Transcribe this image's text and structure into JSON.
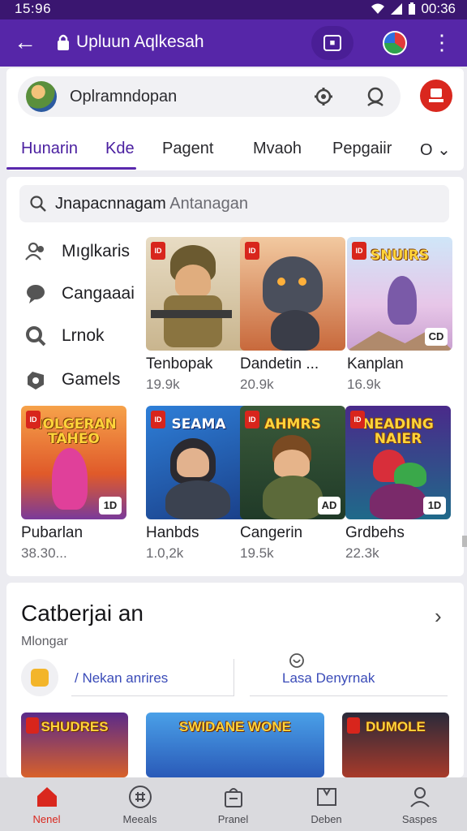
{
  "status_bar": {
    "time": "15:96",
    "clock_right": "00:36"
  },
  "app_bar": {
    "url_text": "Upluun Aqlkesah"
  },
  "top_card": {
    "search_placeholder": "Oplramndopan",
    "tabs": [
      {
        "label": "Hunarin"
      },
      {
        "label": "Kde"
      },
      {
        "label": "Pagent"
      },
      {
        "label": "Mvaoh"
      },
      {
        "label": "Pepgaiir"
      },
      {
        "label": "O"
      }
    ]
  },
  "main": {
    "search_value": "Jnapacnnagam",
    "search_placeholder": "Antanagan",
    "sidebar": [
      {
        "label": "Mıglkaris",
        "icon": "users-icon"
      },
      {
        "label": "Cangaaai",
        "icon": "chat-icon"
      },
      {
        "label": "Lrnok",
        "icon": "search-icon"
      },
      {
        "label": "Gamels",
        "icon": "gamepad-icon"
      }
    ],
    "games_row1": [
      {
        "name": "Tenbopak",
        "count": "19.9k",
        "badge": "ID",
        "banner": ""
      },
      {
        "name": "Dandetin ...",
        "count": "20.9k",
        "badge": "ID",
        "banner": ""
      },
      {
        "name": "Kanplan",
        "count": "16.9k",
        "badge": "ID",
        "banner": "SNUIRS",
        "corner": "CD"
      }
    ],
    "games_row2": [
      {
        "name": "Pubarlan",
        "count": "38.30...",
        "badge": "ID",
        "banner": "NOLGERAN TAHEO",
        "corner": "1D"
      },
      {
        "name": "Hanbds",
        "count": "1.0,2k",
        "badge": "ID",
        "banner": "SEAMA",
        "corner": ""
      },
      {
        "name": "Cangerin",
        "count": "19.5k",
        "badge": "ID",
        "banner": "AHMRS",
        "corner": "AD"
      },
      {
        "name": "Grdbehs",
        "count": "22.3k",
        "badge": "ID",
        "banner": "NEADING NAIER",
        "corner": "1D"
      }
    ]
  },
  "category": {
    "title": "Catberjai an",
    "subtitle": "Mlongar",
    "chip1": "/ Nekan anrires",
    "chip2": "Lasa Denyrnak",
    "strip_banners": [
      "SHUDRES",
      "SWIDANE WONE",
      "DUMOLE"
    ]
  },
  "bottom_nav": [
    {
      "label": "Nenel",
      "icon": "home-icon",
      "active": true
    },
    {
      "label": "Meeals",
      "icon": "grid-circle-icon",
      "active": false
    },
    {
      "label": "Pranel",
      "icon": "bag-icon",
      "active": false
    },
    {
      "label": "Deben",
      "icon": "book-icon",
      "active": false
    },
    {
      "label": "Saspes",
      "icon": "person-icon",
      "active": false
    }
  ],
  "colors": {
    "appbar": "#5626a8",
    "statusbar": "#3a1670",
    "accent": "#5a28ad",
    "danger": "#d9271e"
  }
}
